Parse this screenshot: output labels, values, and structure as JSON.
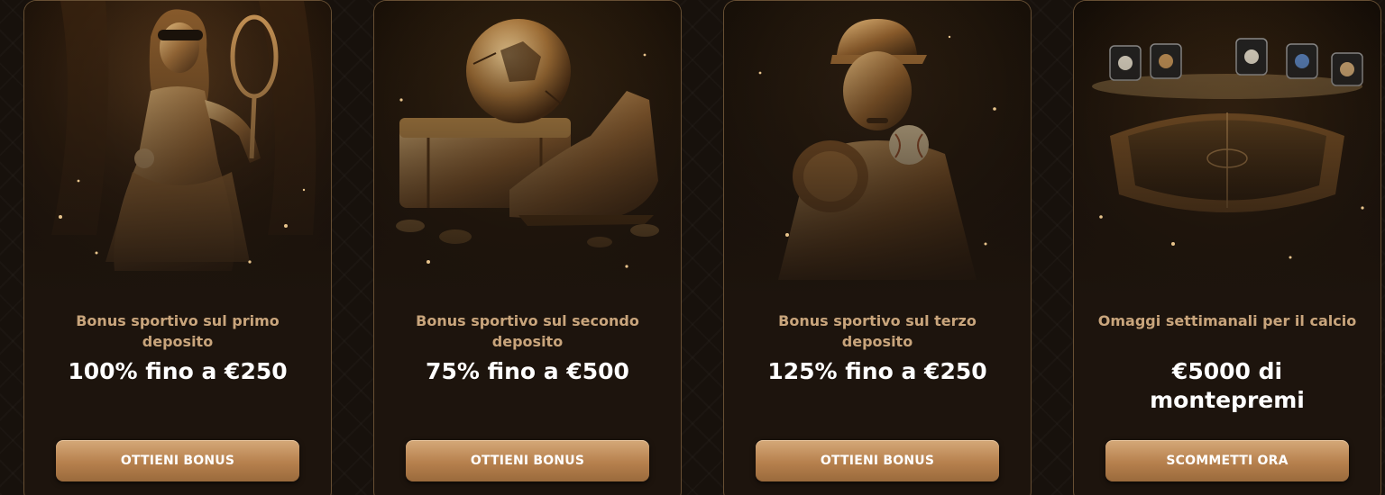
{
  "cards": [
    {
      "title": "Bonus sportivo sul primo deposito",
      "amount": "100% fino a €250",
      "button_label": "OTTIENI BONUS",
      "art": "tennis-player-illustration"
    },
    {
      "title": "Bonus sportivo sul secondo deposito",
      "amount": "75% fino a €500",
      "button_label": "OTTIENI BONUS",
      "art": "football-boot-illustration"
    },
    {
      "title": "Bonus sportivo sul terzo deposito",
      "amount": "125% fino a €250",
      "button_label": "OTTIENI BONUS",
      "art": "baseball-player-illustration"
    },
    {
      "title": "Omaggi settimanali per il calcio",
      "amount": "€5000 di montepremi",
      "button_label": "SCOMMETTI ORA",
      "art": "football-stadium-illustration"
    }
  ],
  "colors": {
    "page_background": "#17110c",
    "card_background": "#1d140d",
    "card_border": "#c49662",
    "title_text": "#c9a57c",
    "amount_text": "#ffffff",
    "button_gold": "#c08b58"
  }
}
